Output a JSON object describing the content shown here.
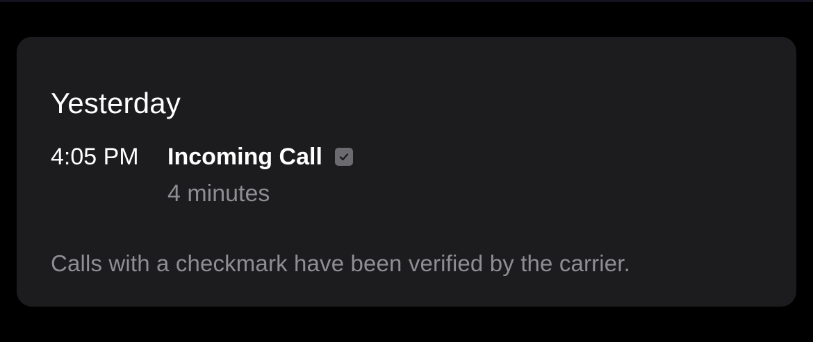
{
  "section": {
    "title": "Yesterday"
  },
  "call": {
    "time": "4:05 PM",
    "type": "Incoming Call",
    "verified_icon": "checkmark-square-icon",
    "duration": "4 minutes"
  },
  "footnote": "Calls with a checkmark have been verified by the carrier.",
  "colors": {
    "background": "#000000",
    "card": "#1c1c1e",
    "primary_text": "#ffffff",
    "secondary_text": "#8e8e93",
    "icon_fill": "#6b6b70"
  }
}
